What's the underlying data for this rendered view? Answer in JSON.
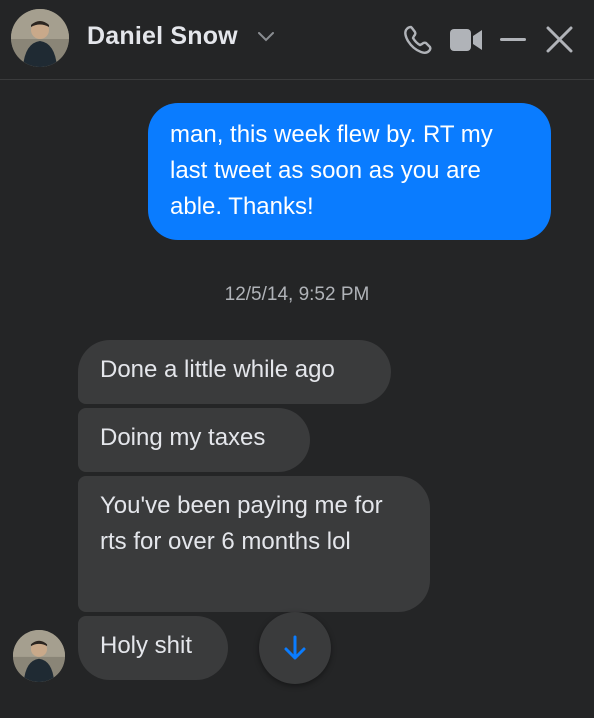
{
  "header": {
    "contact_name": "Daniel Snow",
    "icons": [
      "phone-icon",
      "video-camera-icon",
      "minimize-icon",
      "close-icon",
      "chevron-down-icon"
    ]
  },
  "messages": [
    {
      "direction": "outgoing",
      "text": "man, this week flew by. RT my last tweet as soon as you are able. Thanks!"
    },
    {
      "type": "timestamp",
      "text": "12/5/14, 9:52 PM"
    },
    {
      "direction": "incoming",
      "text": "Done a little while ago"
    },
    {
      "direction": "incoming",
      "text": "Doing my taxes"
    },
    {
      "direction": "incoming",
      "text": "You've been paying me for rts for over 6 months lol"
    },
    {
      "direction": "incoming",
      "text": "Holy shit"
    }
  ],
  "colors": {
    "background": "#242526",
    "outgoing_bubble": "#0a7cff",
    "incoming_bubble": "#3a3b3c",
    "accent_icon": "#0a7cff",
    "muted_icon": "#b0b3b8"
  }
}
